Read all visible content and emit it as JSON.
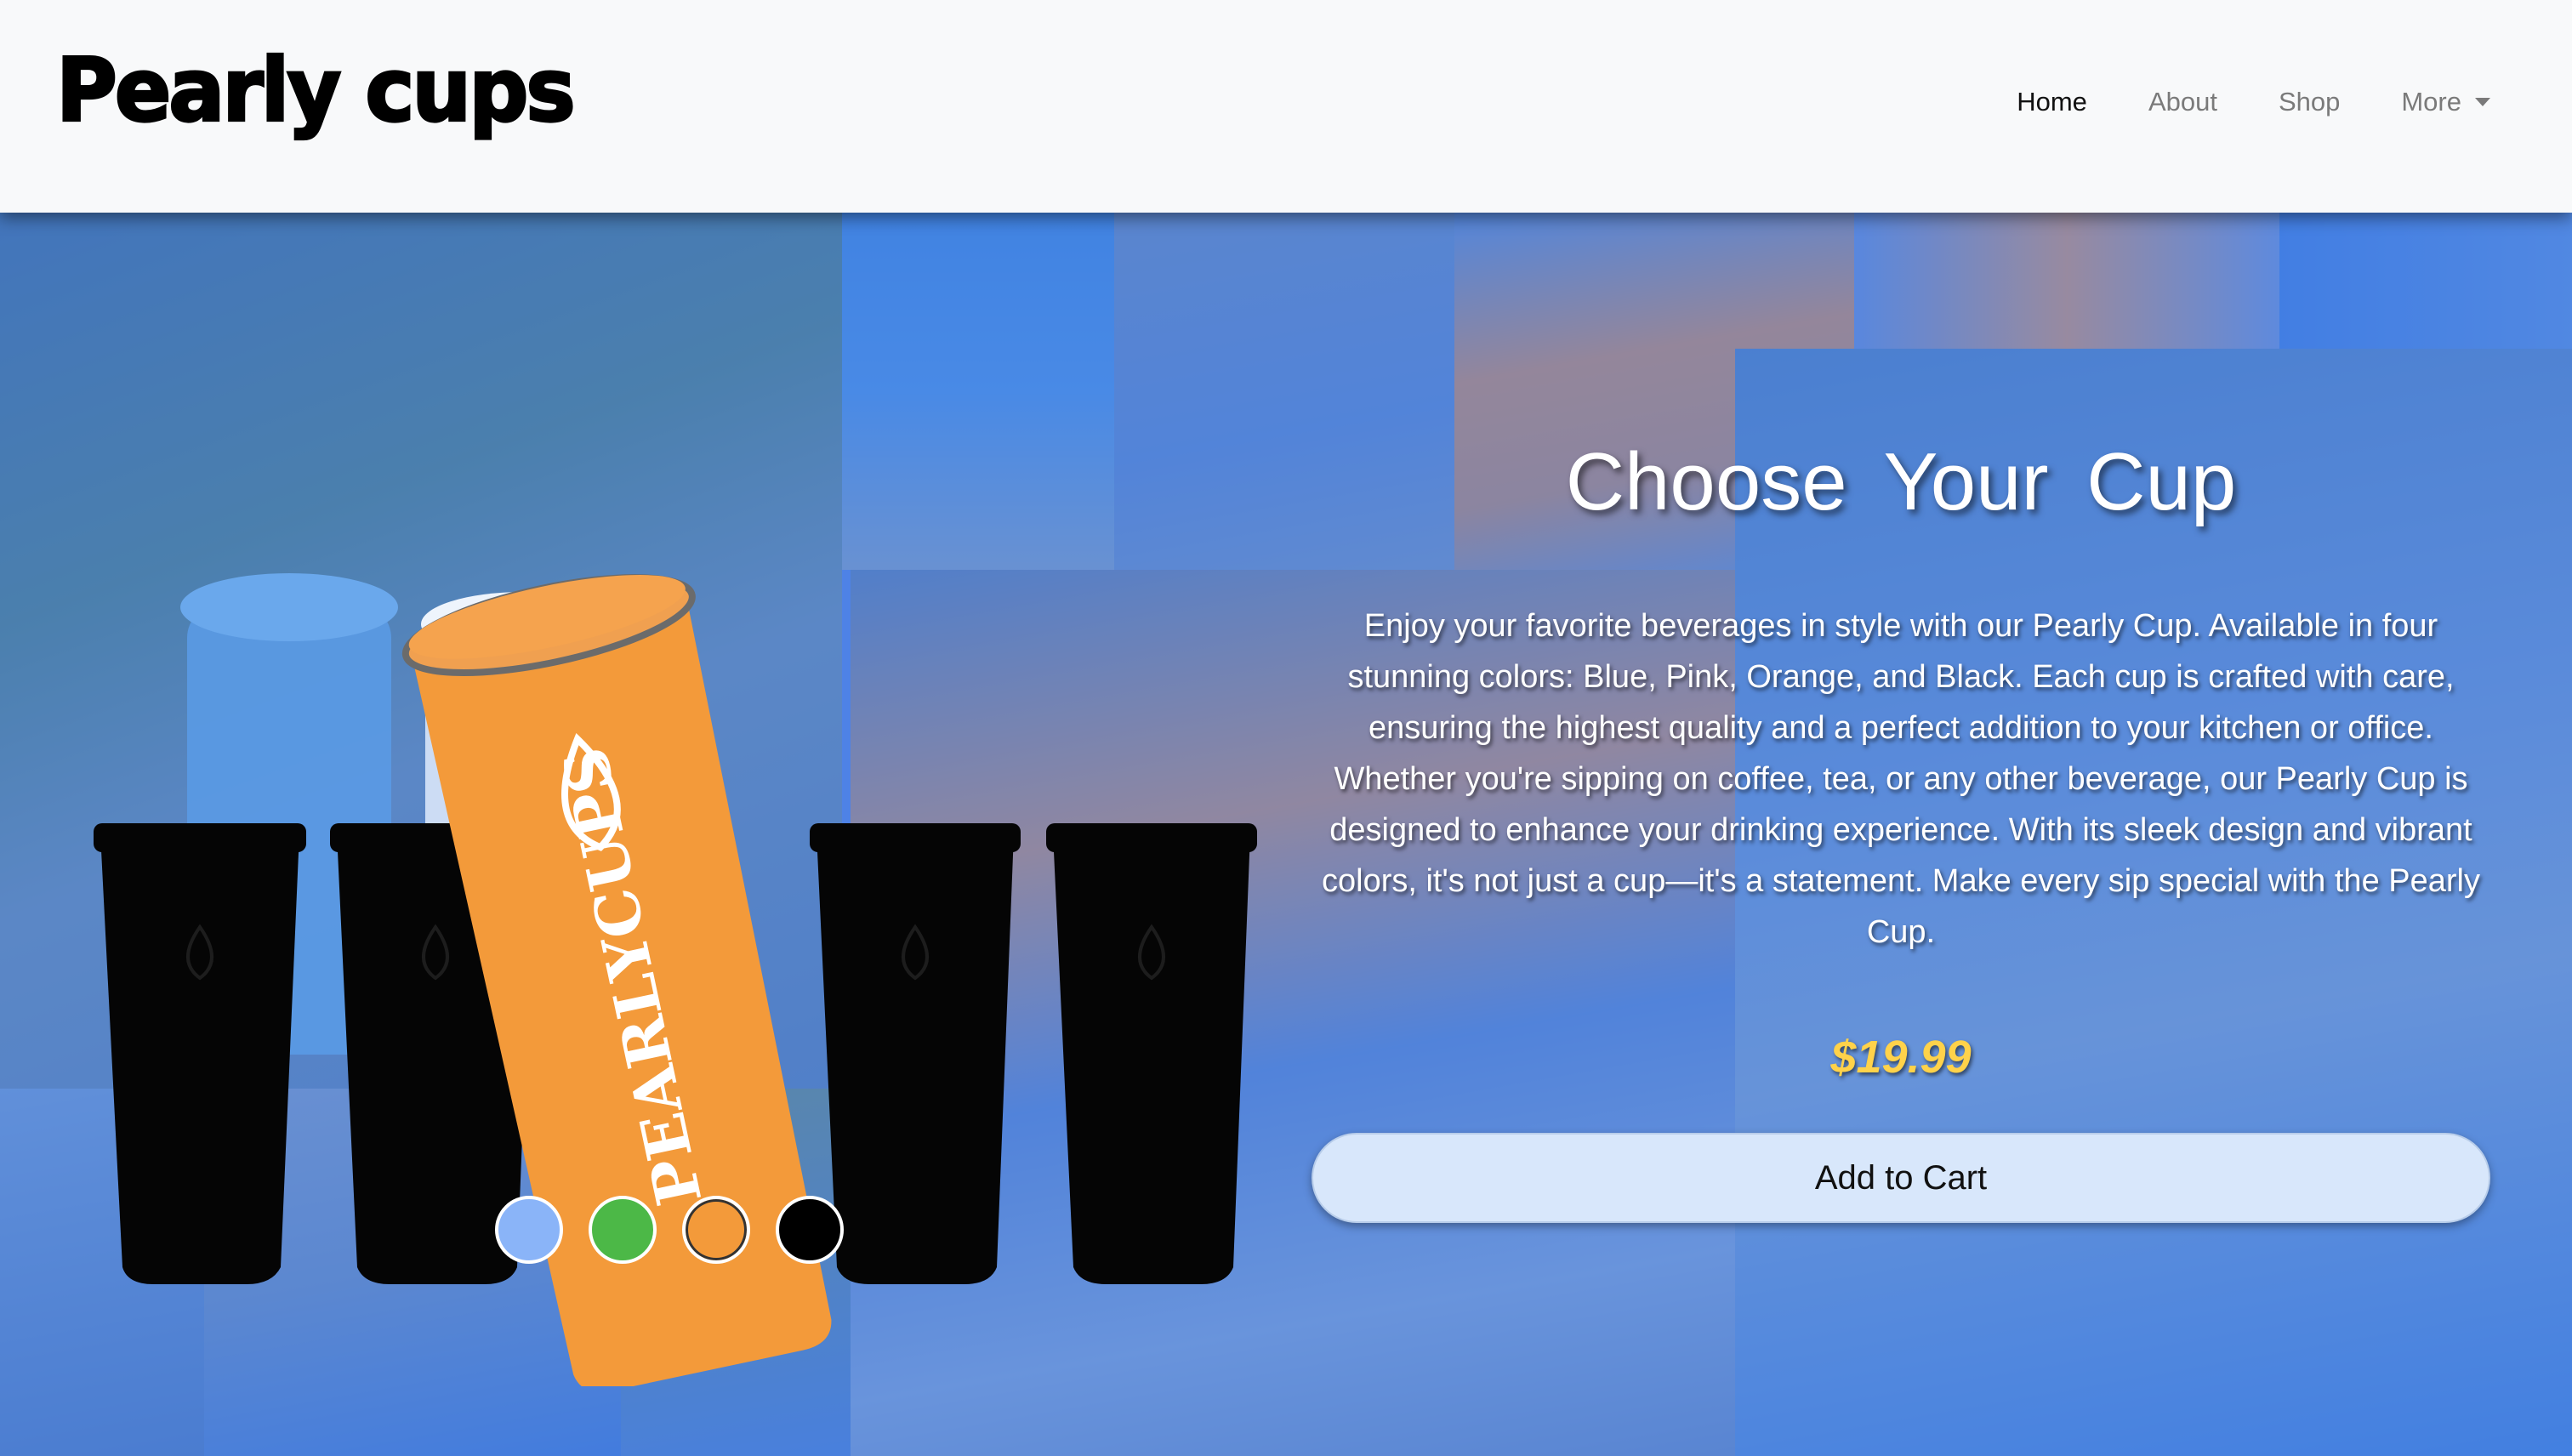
{
  "navbar": {
    "brand": "Pearly cups",
    "links": [
      {
        "label": "Home",
        "active": true
      },
      {
        "label": "About",
        "active": false
      },
      {
        "label": "Shop",
        "active": false
      },
      {
        "label": "More",
        "active": false,
        "dropdown": true
      }
    ]
  },
  "hero": {
    "product_label": "PEARLYCUPS",
    "title": "Choose Your Cup",
    "description": "Enjoy your favorite beverages in style with our Pearly Cup. Available in four stunning colors: Blue, Pink, Orange, and Black. Each cup is crafted with care, ensuring the highest quality and a perfect addition to your kitchen or office. Whether you're sipping on coffee, tea, or any other beverage, our Pearly Cup is designed to enhance your drinking experience. With its sleek design and vibrant colors, it's not just a cup—it's a statement. Make every sip special with the Pearly Cup.",
    "price": "$19.99",
    "add_to_cart": "Add to Cart"
  },
  "swatches": [
    {
      "name": "blue",
      "color": "#8ab4f8",
      "selected": false
    },
    {
      "name": "green",
      "color": "#4cb847",
      "selected": false
    },
    {
      "name": "orange",
      "color": "#f39a3a",
      "selected": true
    },
    {
      "name": "black",
      "color": "#000000",
      "selected": false
    }
  ],
  "colors": {
    "navbar_bg": "#f8f9fa",
    "hero_overlay": "#4f7fdd",
    "price": "#ffd24a",
    "button_bg": "#d8e7fb",
    "cup_orange": "#f39a3a"
  }
}
